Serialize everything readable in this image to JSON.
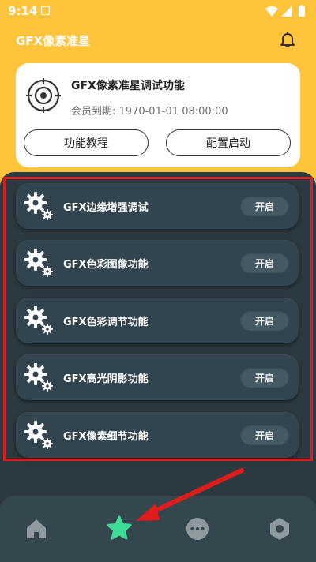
{
  "status_bar": {
    "time": "9:14"
  },
  "header": {
    "title": "GFX像素准星"
  },
  "card": {
    "title": "GFX像素准星调试功能",
    "membership_label": "会员到期:",
    "membership_value": "1970-01-01 08:00:00",
    "tutorial_button": "功能教程",
    "config_button": "配置启动"
  },
  "features": [
    {
      "label": "GFX边缘增强调试",
      "toggle": "开启"
    },
    {
      "label": "GFX色彩图像功能",
      "toggle": "开启"
    },
    {
      "label": "GFX色彩调节功能",
      "toggle": "开启"
    },
    {
      "label": "GFX高光阴影功能",
      "toggle": "开启"
    },
    {
      "label": "GFX像素细节功能",
      "toggle": "开启"
    }
  ],
  "nav": [
    "home-icon",
    "star-icon",
    "more-icon",
    "hexagon-icon"
  ],
  "colors": {
    "header_bg": "#ffc43b",
    "panel_bg": "#2b3940",
    "row_bg": "#32444d",
    "nav_active": "#3ddc97",
    "annotation": "#e01b1b"
  }
}
